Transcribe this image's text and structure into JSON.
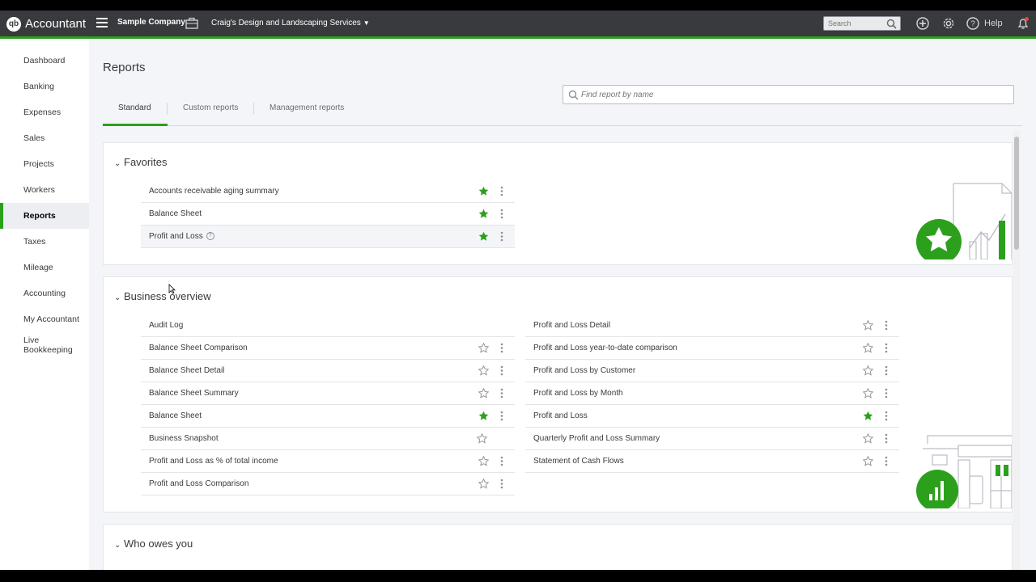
{
  "topbar": {
    "logo_mark": "qb",
    "app_name": "Accountant",
    "company_label": "Sample Company",
    "client_name": "Craig's Design and Landscaping Services",
    "search_placeholder": "Search",
    "help_label": "Help"
  },
  "sidebar": {
    "items": [
      {
        "label": "Dashboard"
      },
      {
        "label": "Banking"
      },
      {
        "label": "Expenses"
      },
      {
        "label": "Sales"
      },
      {
        "label": "Projects"
      },
      {
        "label": "Workers"
      },
      {
        "label": "Reports",
        "active": true
      },
      {
        "label": "Taxes"
      },
      {
        "label": "Mileage"
      },
      {
        "label": "Accounting"
      },
      {
        "label": "My Accountant"
      },
      {
        "label_line1": "Live",
        "label_line2": "Bookkeeping"
      }
    ]
  },
  "main": {
    "title": "Reports",
    "tabs": [
      {
        "label": "Standard",
        "active": true
      },
      {
        "label": "Custom reports"
      },
      {
        "label": "Management reports"
      }
    ],
    "find_placeholder": "Find report by name",
    "favorites": {
      "heading": "Favorites",
      "items": [
        {
          "label": "Accounts receivable aging summary",
          "starred": true
        },
        {
          "label": "Balance Sheet",
          "starred": true
        },
        {
          "label": "Profit and Loss",
          "starred": true,
          "help": "?"
        }
      ]
    },
    "business_overview": {
      "heading": "Business overview",
      "left": [
        {
          "label": "Audit Log"
        },
        {
          "label": "Balance Sheet Comparison"
        },
        {
          "label": "Balance Sheet Detail"
        },
        {
          "label": "Balance Sheet Summary"
        },
        {
          "label": "Balance Sheet",
          "starred": true
        },
        {
          "label": "Business Snapshot"
        },
        {
          "label": "Profit and Loss as % of total income"
        },
        {
          "label": "Profit and Loss Comparison"
        }
      ],
      "right": [
        {
          "label": "Profit and Loss Detail"
        },
        {
          "label": "Profit and Loss year-to-date comparison"
        },
        {
          "label": "Profit and Loss by Customer"
        },
        {
          "label": "Profit and Loss by Month"
        },
        {
          "label": "Profit and Loss",
          "starred": true
        },
        {
          "label": "Quarterly Profit and Loss Summary"
        },
        {
          "label": "Statement of Cash Flows"
        }
      ]
    },
    "who_owes_you": {
      "heading": "Who owes you"
    }
  },
  "colors": {
    "accent": "#2ca01c",
    "topbar": "#393a3d",
    "page_bg": "#f4f5f8",
    "star_off": "#8d9096"
  }
}
